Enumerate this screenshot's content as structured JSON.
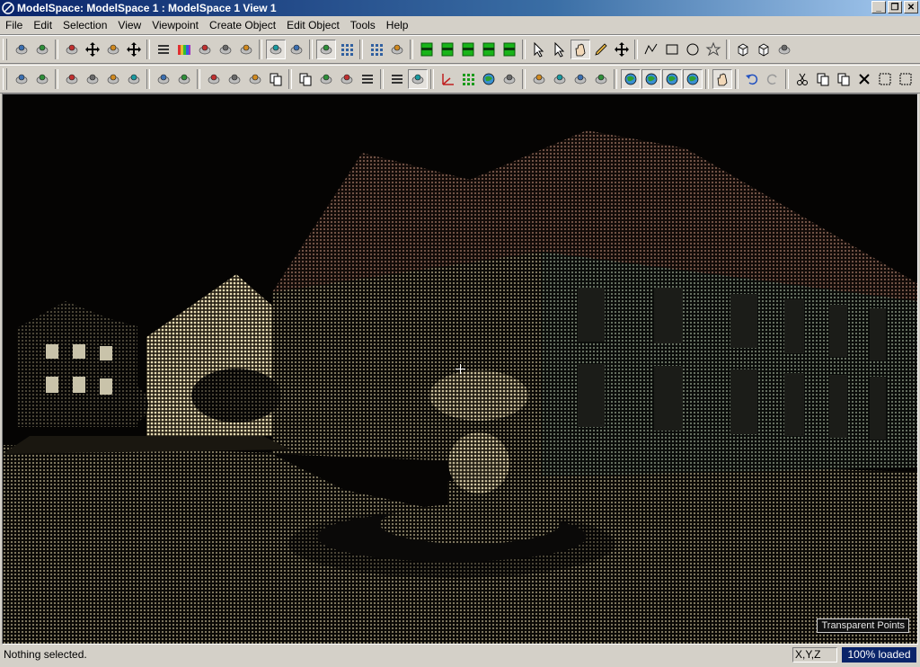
{
  "window": {
    "title": "ModelSpace: ModelSpace 1 : ModelSpace 1 View 1",
    "minimize": "_",
    "restore": "❐",
    "close": "✕"
  },
  "menu": [
    {
      "label": "File"
    },
    {
      "label": "Edit"
    },
    {
      "label": "Selection"
    },
    {
      "label": "View"
    },
    {
      "label": "Viewpoint"
    },
    {
      "label": "Create Object"
    },
    {
      "label": "Edit Object"
    },
    {
      "label": "Tools"
    },
    {
      "label": "Help"
    }
  ],
  "toolbar1": [
    "select-cloud-icon",
    "add-points-icon",
    "fence-icon",
    "fence-remove-icon",
    "link-icon",
    "link-remove-icon",
    "layer-add-icon",
    "color-bands-icon",
    "intensity-icon",
    "render-icon",
    "shade-icon",
    "cloud-view-icon",
    "display-icon",
    "transparent-icon",
    "grid-icon",
    "grid-dots-icon",
    "delete-icon",
    "slice-green-1-icon",
    "slice-green-2-icon",
    "slice-green-3-icon",
    "slice-green-4-icon",
    "slice-green-5-icon",
    "pointer-icon",
    "pick-pointer-icon",
    "hand-pan-icon",
    "pencil-icon",
    "move-icon",
    "polyline-icon",
    "rectangle-icon",
    "circle-icon",
    "star-icon",
    "box-icon",
    "cube-icon",
    "rotate-icon"
  ],
  "toolbar2": [
    "fit-icon",
    "sphere-fit-icon",
    "cylinder-1-icon",
    "cylinder-2-icon",
    "cylinder-3-icon",
    "cylinder-4-icon",
    "mesh-green-icon",
    "mesh-edit-icon",
    "merge-icon",
    "split-icon",
    "split-2-icon",
    "copy-object-icon",
    "paste-object-icon",
    "hide-object-icon",
    "wand-icon",
    "layer-icon",
    "list-icon",
    "cursor-icon",
    "axes-icon",
    "grid-green-icon",
    "globe-icon",
    "ruler-icon",
    "section-1-icon",
    "section-2-icon",
    "section-3-icon",
    "section-4-icon",
    "scan-world-1-icon",
    "scan-world-2-icon",
    "scan-world-3-icon",
    "scan-world-4-icon",
    "hand-select-icon",
    "undo-icon",
    "redo-icon",
    "cut-icon",
    "copy-icon",
    "paste-icon",
    "delete-x-icon",
    "zoom-extents-icon",
    "zoom-window-icon"
  ],
  "viewport": {
    "overlay_label": "Transparent Points"
  },
  "status": {
    "message": "Nothing selected.",
    "coords_label": "X,Y,Z",
    "loaded": "100% loaded"
  },
  "colors": {
    "title_start": "#0a246a",
    "title_end": "#a6caf0",
    "chrome": "#d4d0c8",
    "viewport_bg": "#050403",
    "loaded_bg": "#0a246a"
  }
}
